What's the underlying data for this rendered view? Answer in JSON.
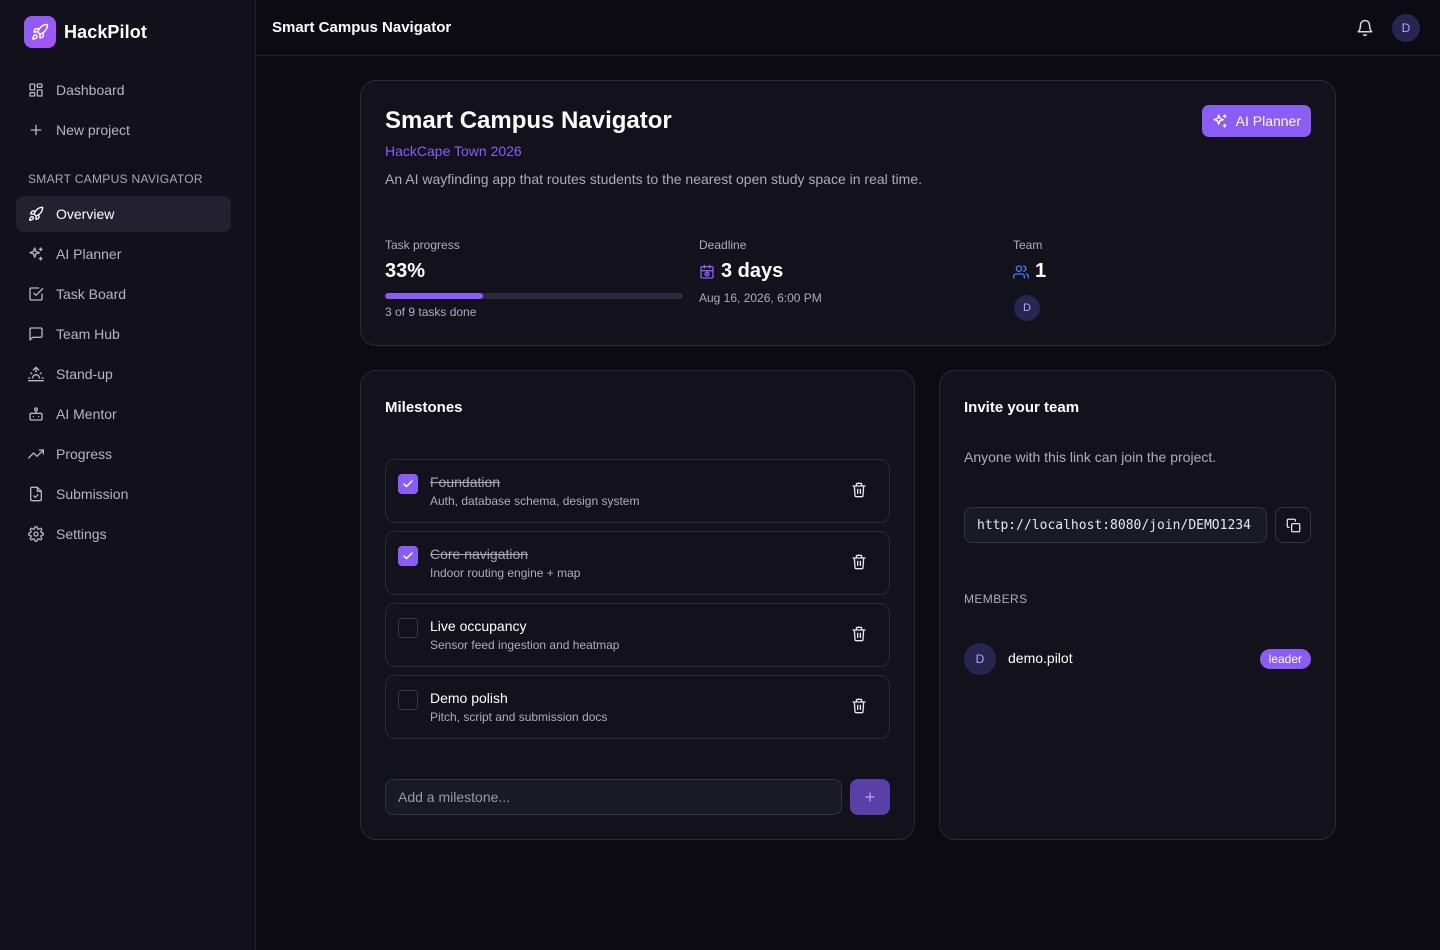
{
  "app": {
    "name": "HackPilot"
  },
  "sidebar": {
    "top_items": [
      {
        "label": "Dashboard",
        "icon": "dashboard-icon"
      },
      {
        "label": "New project",
        "icon": "plus-icon"
      }
    ],
    "section_label": "SMART CAMPUS NAVIGATOR",
    "project_items": [
      {
        "label": "Overview",
        "icon": "rocket-icon",
        "active": true
      },
      {
        "label": "AI Planner",
        "icon": "sparkles-icon"
      },
      {
        "label": "Task Board",
        "icon": "check-square-icon"
      },
      {
        "label": "Team Hub",
        "icon": "message-square-icon"
      },
      {
        "label": "Stand-up",
        "icon": "sunrise-icon"
      },
      {
        "label": "AI Mentor",
        "icon": "bot-icon"
      },
      {
        "label": "Progress",
        "icon": "trending-up-icon"
      },
      {
        "label": "Submission",
        "icon": "file-check-icon"
      },
      {
        "label": "Settings",
        "icon": "gear-icon"
      }
    ]
  },
  "header": {
    "title": "Smart Campus Navigator",
    "avatar_initial": "D"
  },
  "project": {
    "title": "Smart Campus Navigator",
    "event": "HackCape Town 2026",
    "description": "An AI wayfinding app that routes students to the nearest open study space in real time.",
    "ai_button_label": "AI Planner",
    "stats": {
      "progress_label": "Task progress",
      "progress_value": "33%",
      "progress_fraction": 0.33,
      "progress_sub": "3 of 9 tasks done",
      "deadline_label": "Deadline",
      "deadline_value": "3 days",
      "deadline_sub": "Aug 16, 2026, 6:00 PM",
      "team_label": "Team",
      "team_value": "1",
      "team_avatar_initial": "D"
    }
  },
  "milestones": {
    "heading": "Milestones",
    "items": [
      {
        "title": "Foundation",
        "desc": "Auth, database schema, design system",
        "done": true
      },
      {
        "title": "Core navigation",
        "desc": "Indoor routing engine + map",
        "done": true
      },
      {
        "title": "Live occupancy",
        "desc": "Sensor feed ingestion and heatmap",
        "done": false
      },
      {
        "title": "Demo polish",
        "desc": "Pitch, script and submission docs",
        "done": false
      }
    ],
    "add_placeholder": "Add a milestone..."
  },
  "invite": {
    "heading": "Invite your team",
    "description": "Anyone with this link can join the project.",
    "link": "http://localhost:8080/join/DEMO1234",
    "members_label": "MEMBERS",
    "members": [
      {
        "initial": "D",
        "name": "demo.pilot",
        "role": "leader"
      }
    ]
  },
  "colors": {
    "accent": "#8b5cf6",
    "background": "#0c0b14",
    "card": "#13121c",
    "sidebar": "#12111b"
  }
}
